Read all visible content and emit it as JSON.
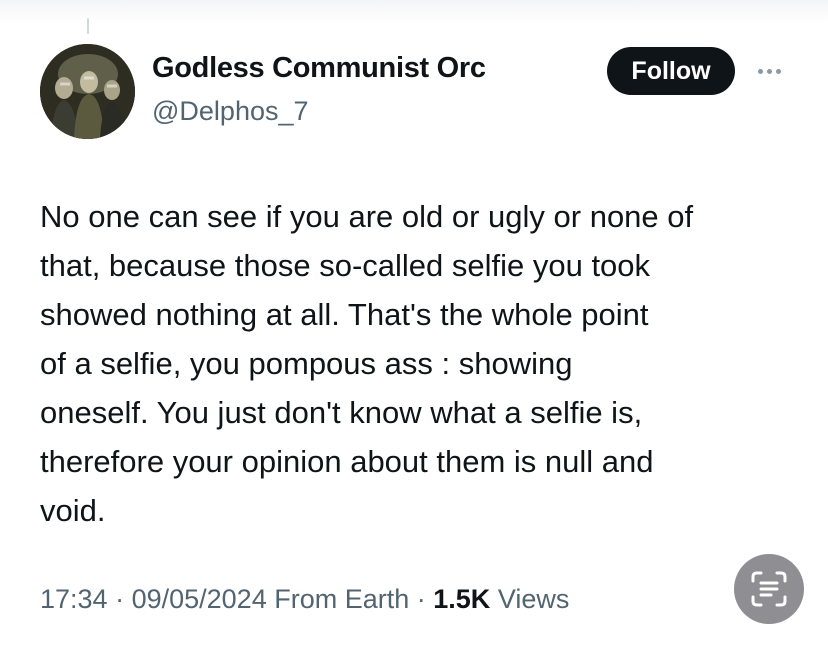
{
  "author": {
    "display_name": "Godless Communist Orc",
    "handle": "@Delphos_7",
    "avatar_icon": "profile-avatar"
  },
  "actions": {
    "follow_label": "Follow",
    "more_icon": "more-dots-icon"
  },
  "tweet": {
    "lines": [
      "No one can see if you are old or ugly or none of",
      "that, because those so-called selfie you took",
      "showed nothing at all. That's the whole point",
      "of a selfie, you pompous ass : showing",
      "oneself. You just don't know what a selfie is,",
      "therefore your opinion about them is null and",
      "void."
    ]
  },
  "meta": {
    "time": "17:34",
    "separator": " · ",
    "date": "09/05/2024",
    "location": "From Earth",
    "views_count": "1.5K",
    "views_label": "Views"
  },
  "overlay": {
    "scan_icon": "text-scan-icon"
  },
  "colors": {
    "primary_text": "#0f1419",
    "secondary_text": "#536471",
    "follow_bg": "#0f1419",
    "follow_text": "#ffffff",
    "scan_bg": "#8e8e93"
  }
}
